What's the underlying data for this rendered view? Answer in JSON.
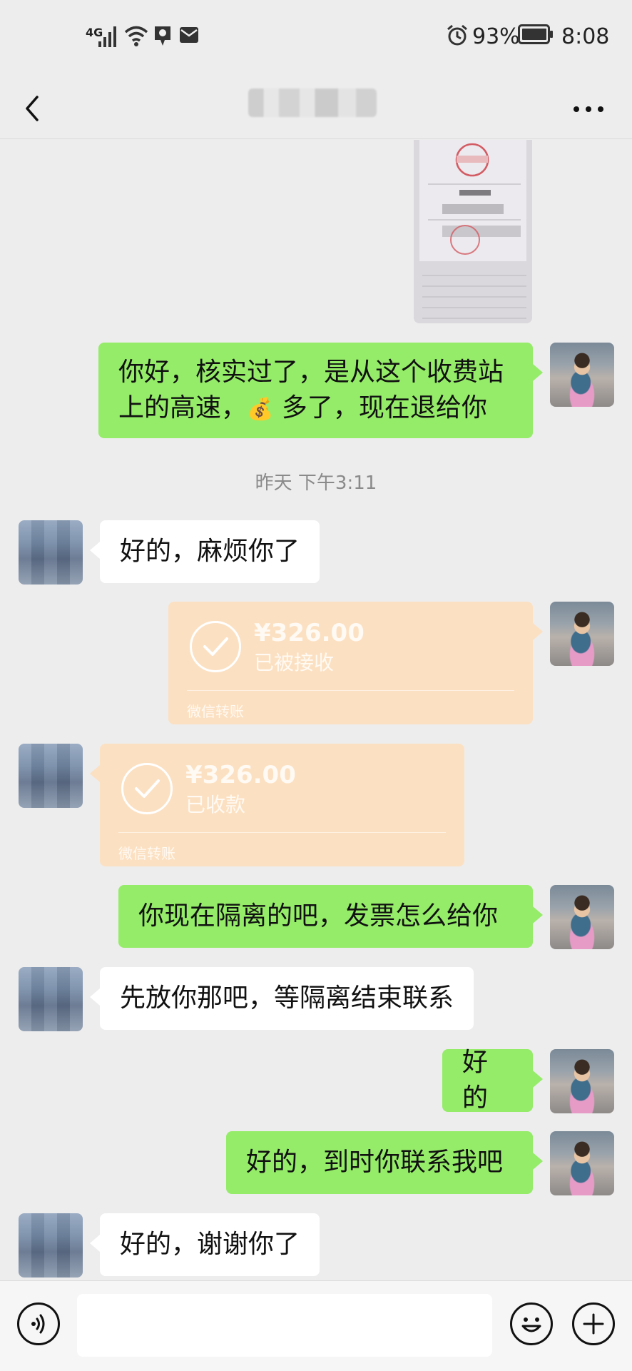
{
  "status_bar": {
    "network": "4G",
    "battery": "93%",
    "time": "8:08"
  },
  "header": {
    "title": "",
    "back_icon": "chevron-left-icon",
    "more_icon": "more-horizontal-icon"
  },
  "messages": {
    "m1_line1": "你好，核实过了，是从这个收费站",
    "m1_line2_a": "上的高速，",
    "m1_emoji": "💰",
    "m1_line2_b": " 多了，现在退给你",
    "timestamp": "昨天 下午3:11",
    "m2": "好的，麻烦你了",
    "m5": "你现在隔离的吧，发票怎么给你",
    "m6": "先放你那吧，等隔离结束联系",
    "m7": "好的",
    "m8": "好的，到时你联系我吧",
    "m9": "好的，谢谢你了"
  },
  "transfers": {
    "t1": {
      "amount": "¥326.00",
      "status": "已被接收",
      "footer": "微信转账"
    },
    "t2": {
      "amount": "¥326.00",
      "status": "已收款",
      "footer": "微信转账"
    }
  },
  "input_bar": {
    "voice_icon": "voice-icon",
    "emoji_icon": "emoji-icon",
    "plus_icon": "plus-icon"
  },
  "colors": {
    "background": "#ededed",
    "my_bubble": "#95ec69",
    "their_bubble": "#ffffff",
    "transfer_card": "#fce0c2"
  }
}
